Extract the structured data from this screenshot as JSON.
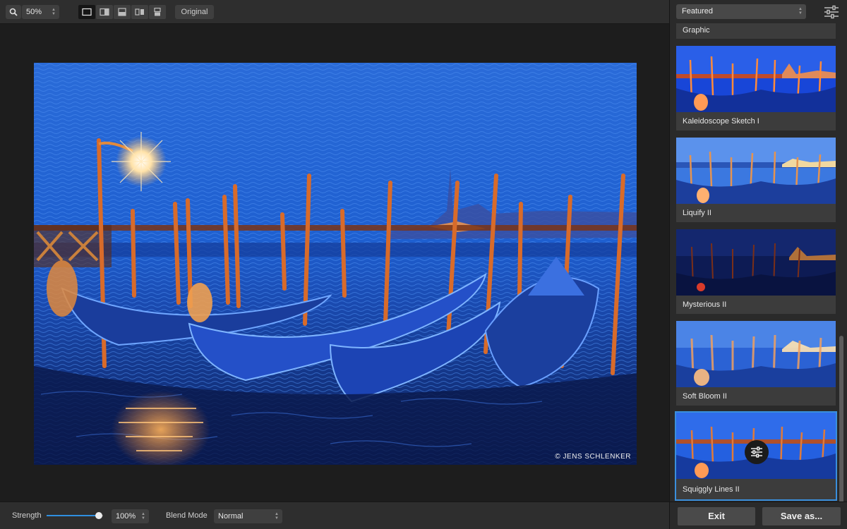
{
  "toolbar": {
    "zoom_value": "50%",
    "original_label": "Original",
    "view_modes": [
      "single-view-icon",
      "split-vertical-icon",
      "split-horizontal-icon",
      "side-by-side-icon",
      "stacked-icon"
    ]
  },
  "canvas": {
    "copyright_text": "© JENS SCHLENKER"
  },
  "bottom": {
    "strength_label": "Strength",
    "strength_value": "100%",
    "strength_fraction": 1.0,
    "blend_label": "Blend Mode",
    "blend_value": "Normal"
  },
  "panel": {
    "category": "Featured",
    "presets": [
      {
        "label": "Graphic"
      },
      {
        "label": "Kaleidoscope Sketch I"
      },
      {
        "label": "Liquify II"
      },
      {
        "label": "Mysterious II"
      },
      {
        "label": "Soft Bloom II"
      },
      {
        "label": "Squiggly Lines II"
      }
    ],
    "exit_label": "Exit",
    "save_label": "Save as..."
  },
  "colors": {
    "accent": "#2f8fdf",
    "selection": "#3a8fdc"
  }
}
